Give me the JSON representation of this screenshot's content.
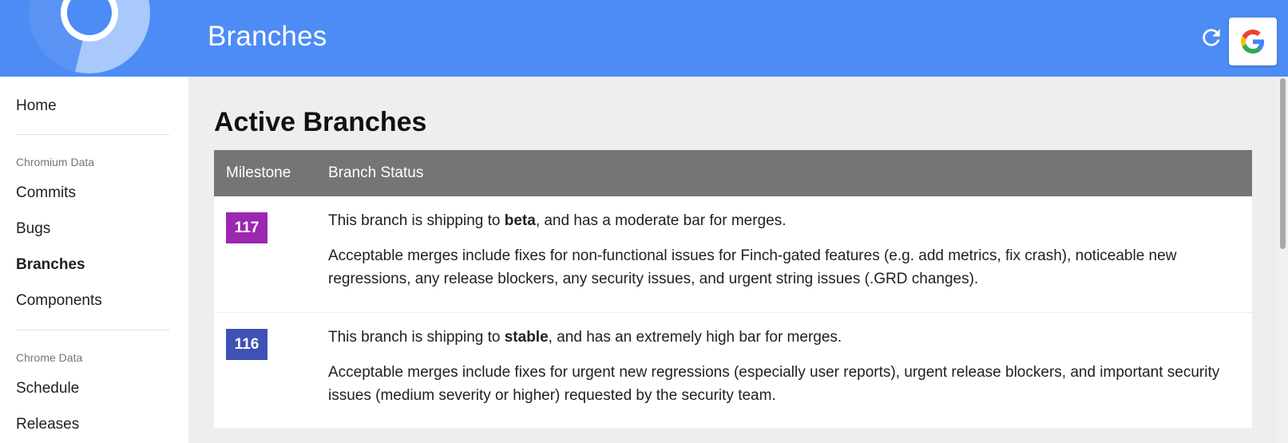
{
  "header": {
    "title": "Branches",
    "brand_color": "#4d8cf5",
    "refresh_icon": "refresh-icon",
    "account_icon": "google-g-icon"
  },
  "sidebar": {
    "home": "Home",
    "section_chromium": "Chromium Data",
    "commits": "Commits",
    "bugs": "Bugs",
    "branches": "Branches",
    "components": "Components",
    "section_chrome": "Chrome Data",
    "schedule": "Schedule",
    "releases": "Releases",
    "active_item": "Branches"
  },
  "main": {
    "title": "Active Branches",
    "table": {
      "headers": {
        "milestone": "Milestone",
        "status": "Branch Status"
      },
      "rows": [
        {
          "milestone": "117",
          "badge_color": "#9c27b0",
          "status_prefix": "This branch is shipping to ",
          "channel": "beta",
          "status_suffix": ", and has a moderate bar for merges.",
          "details": "Acceptable merges include fixes for non-functional issues for Finch-gated features (e.g. add metrics, fix crash), noticeable new regressions, any release blockers, any security issues, and urgent string issues (.GRD changes)."
        },
        {
          "milestone": "116",
          "badge_color": "#3f51b5",
          "status_prefix": "This branch is shipping to ",
          "channel": "stable",
          "status_suffix": ", and has an extremely high bar for merges.",
          "details": "Acceptable merges include fixes for urgent new regressions (especially user reports), urgent release blockers, and important security issues (medium severity or higher) requested by the security team."
        }
      ]
    }
  }
}
